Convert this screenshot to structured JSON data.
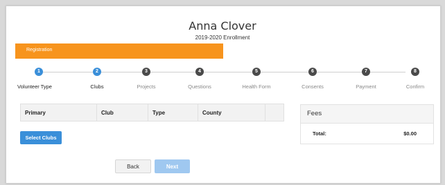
{
  "header": {
    "name": "Anna Clover",
    "enrollment": "2019-2020 Enrollment"
  },
  "registration": {
    "label": "Registration",
    "color": "#f7941d"
  },
  "steps": [
    {
      "number": "1",
      "label": "Volunteer Type",
      "state": "completed"
    },
    {
      "number": "2",
      "label": "Clubs",
      "state": "current"
    },
    {
      "number": "3",
      "label": "Projects",
      "state": "upcoming"
    },
    {
      "number": "4",
      "label": "Questions",
      "state": "upcoming"
    },
    {
      "number": "5",
      "label": "Health Form",
      "state": "upcoming"
    },
    {
      "number": "6",
      "label": "Consents",
      "state": "upcoming"
    },
    {
      "number": "7",
      "label": "Payment",
      "state": "upcoming"
    },
    {
      "number": "8",
      "label": "Confirm",
      "state": "upcoming"
    }
  ],
  "clubs_table": {
    "columns": [
      "Primary",
      "Club",
      "Type",
      "County",
      ""
    ]
  },
  "select_clubs_label": "Select Clubs",
  "fees": {
    "title": "Fees",
    "total_label": "Total:",
    "total_value": "$0.00"
  },
  "nav": {
    "back_label": "Back",
    "next_label": "Next"
  },
  "colors": {
    "accent": "#3a8fd9",
    "step_inactive": "#4a4a4a",
    "next_disabled": "#9fc8f0"
  }
}
